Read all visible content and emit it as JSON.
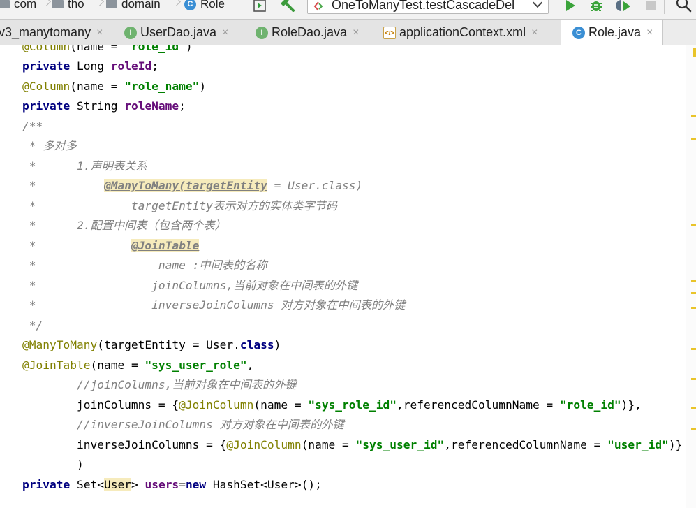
{
  "navbar": {
    "crumbs": [
      {
        "label": "com",
        "icon": "folder-icon"
      },
      {
        "label": "tho",
        "icon": "folder-icon"
      },
      {
        "label": "domain",
        "icon": "folder-icon"
      },
      {
        "label": "Role",
        "icon": "class-icon"
      }
    ],
    "class_icon_glyph": "C",
    "run_config": "OneToManyTest.testCascadeDel",
    "tools": [
      "structure-icon",
      "build-hammer-icon",
      "run-icon",
      "debug-icon",
      "coverage-icon",
      "stop-icon",
      "search-icon"
    ]
  },
  "tabs": [
    {
      "label": "v3_manytomany",
      "icon": "module-icon",
      "glyph": "",
      "active": false
    },
    {
      "label": "UserDao.java",
      "icon": "interface-icon",
      "glyph": "I",
      "active": false
    },
    {
      "label": "RoleDao.java",
      "icon": "interface-icon",
      "glyph": "I",
      "active": false
    },
    {
      "label": "applicationContext.xml",
      "icon": "spring-xml-icon",
      "glyph": "</>",
      "active": false
    },
    {
      "label": "Role.java",
      "icon": "class-icon",
      "glyph": "C",
      "active": true
    }
  ],
  "tab_close_glyph": "×",
  "code": {
    "line0": {
      "ann": "@Column",
      "p1": "(name = ",
      "s1": "\"role_id\"",
      "p2": ")"
    },
    "line1": {
      "kw": "private",
      "p1": " Long ",
      "fld": "roleId",
      "p2": ";"
    },
    "line2": {
      "ann": "@Column",
      "p1": "(name = ",
      "s1": "\"role_name\"",
      "p2": ")"
    },
    "line3": {
      "kw": "private",
      "p1": " String ",
      "fld": "roleName",
      "p2": ";"
    },
    "line4": {
      "c": "/**"
    },
    "line5": {
      "c": " * 多对多"
    },
    "line6": {
      "c": " *      1.声明表关系"
    },
    "line7": {
      "c1": " *          ",
      "hl": "@ManyToMany(targetEntity",
      "c2": " = User.class)"
    },
    "line8": {
      "c": " *              targetEntity表示对方的实体类字节码"
    },
    "line9": {
      "c": " *      2.配置中间表（包含两个表）"
    },
    "line10": {
      "c1": " *              ",
      "hl": "@JoinTable"
    },
    "line11": {
      "c": " *                  name :中间表的名称"
    },
    "line12": {
      "c": " *                 joinColumns,当前对象在中间表的外键"
    },
    "line13": {
      "c": " *                 inverseJoinColumns 对方对象在中间表的外键"
    },
    "line14": {
      "c": " */"
    },
    "line15": {
      "ann": "@ManyToMany",
      "p1": "(targetEntity = User.",
      "kw": "class",
      "p2": ")"
    },
    "line16": {
      "ann": "@JoinTable",
      "p1": "(name = ",
      "s1": "\"sys_user_role\"",
      "p2": ","
    },
    "line17": {
      "c": "        //joinColumns,当前对象在中间表的外键"
    },
    "line18": {
      "p0": "        joinColumns = {",
      "ann": "@JoinColumn",
      "p1": "(name = ",
      "s1": "\"sys_role_id\"",
      "p2": ",referencedColumnName = ",
      "s2": "\"role_id\"",
      "p3": ")},"
    },
    "line19": {
      "c": "        //inverseJoinColumns 对方对象在中间表的外键"
    },
    "line20": {
      "p0": "        inverseJoinColumns = {",
      "ann": "@JoinColumn",
      "p1": "(name = ",
      "s1": "\"sys_user_id\"",
      "p2": ",referencedColumnName = ",
      "s2": "\"user_id\"",
      "p3": ")}"
    },
    "line21": {
      "p0": "        )"
    },
    "line22": {
      "kw": "private",
      "p1": " Set<",
      "hl": "User",
      "p2": "> ",
      "fld": "users",
      "p3": "=",
      "kw2": "new",
      "p4": " HashSet<User>();"
    }
  },
  "colors": {
    "keyword": "#000080",
    "annotation": "#808000",
    "field": "#660e7a",
    "string": "#008000",
    "comment": "#808080",
    "highlight": "#f6ebbc",
    "marker": "#e9c42a"
  }
}
